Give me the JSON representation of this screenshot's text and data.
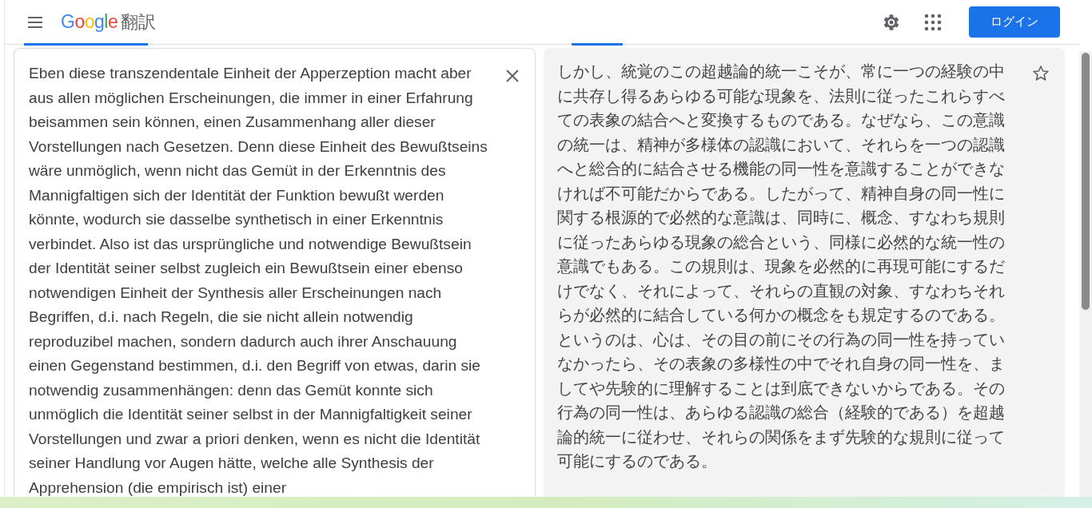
{
  "header": {
    "logo": "Google",
    "product": "翻訳",
    "login_button": "ログイン"
  },
  "source": {
    "text": "Eben diese transzendentale Einheit der Apperzeption macht aber aus allen möglichen Erscheinungen, die immer in einer Erfahrung beisammen sein können, einen Zusammenhang aller dieser Vorstellungen nach Gesetzen. Denn diese Einheit des Bewußtseins wäre unmöglich, wenn nicht das Gemüt in der Erkenntnis des Mannigfaltigen sich der Identität der Funktion bewußt werden könnte, wodurch sie dasselbe synthetisch in einer Erkenntnis verbindet. Also ist das ursprüngliche und notwendige Bewußtsein der Identität seiner selbst zugleich ein Bewußtsein einer ebenso notwendigen Einheit der Synthesis aller Erscheinungen nach Begriffen, d.i. nach Regeln, die sie nicht allein notwendig reproduzibel machen, sondern dadurch auch ihrer Anschauung einen Gegenstand bestimmen, d.i. den Begriff von etwas, darin sie notwendig zusammenhängen: denn das Gemüt konnte sich unmöglich die Identität seiner selbst in der Mannigfaltigkeit seiner Vorstellungen und zwar a priori denken, wenn es nicht die Identität seiner Handlung vor Augen hätte, welche alle Synthesis der Apprehension (die empirisch ist) einer"
  },
  "translation": {
    "text": "しかし、統覚のこの超越論的統一こそが、常に一つの経験の中に共存し得るあらゆる可能な現象を、法則に従ったこれらすべての表象の結合へと変換するものである。なぜなら、この意識の統一は、精神が多様体の認識において、それらを一つの認識へと総合的に結合させる機能の同一性を意識することができなければ不可能だからである。したがって、精神自身の同一性に関する根源的で必然的な意識は、同時に、概念、すなわち規則に従ったあらゆる現象の総合という、同様に必然的な統一性の意識でもある。この規則は、現象を必然的に再現可能にするだけでなく、それによって、それらの直観の対象、すなわちそれらが必然的に結合している何かの概念をも規定するのである。というのは、心は、その目の前にその行為の同一性を持っていなかったら、その表象の多様性の中でそれ自身の同一性を、ましてや先験的に理解することは到底できないからである。その行為の同一性は、あらゆる認識の総合（経験的である）を超越論的統一に従わせ、それらの関係をまず先験的な規則に従って可能にするのである。"
  }
}
